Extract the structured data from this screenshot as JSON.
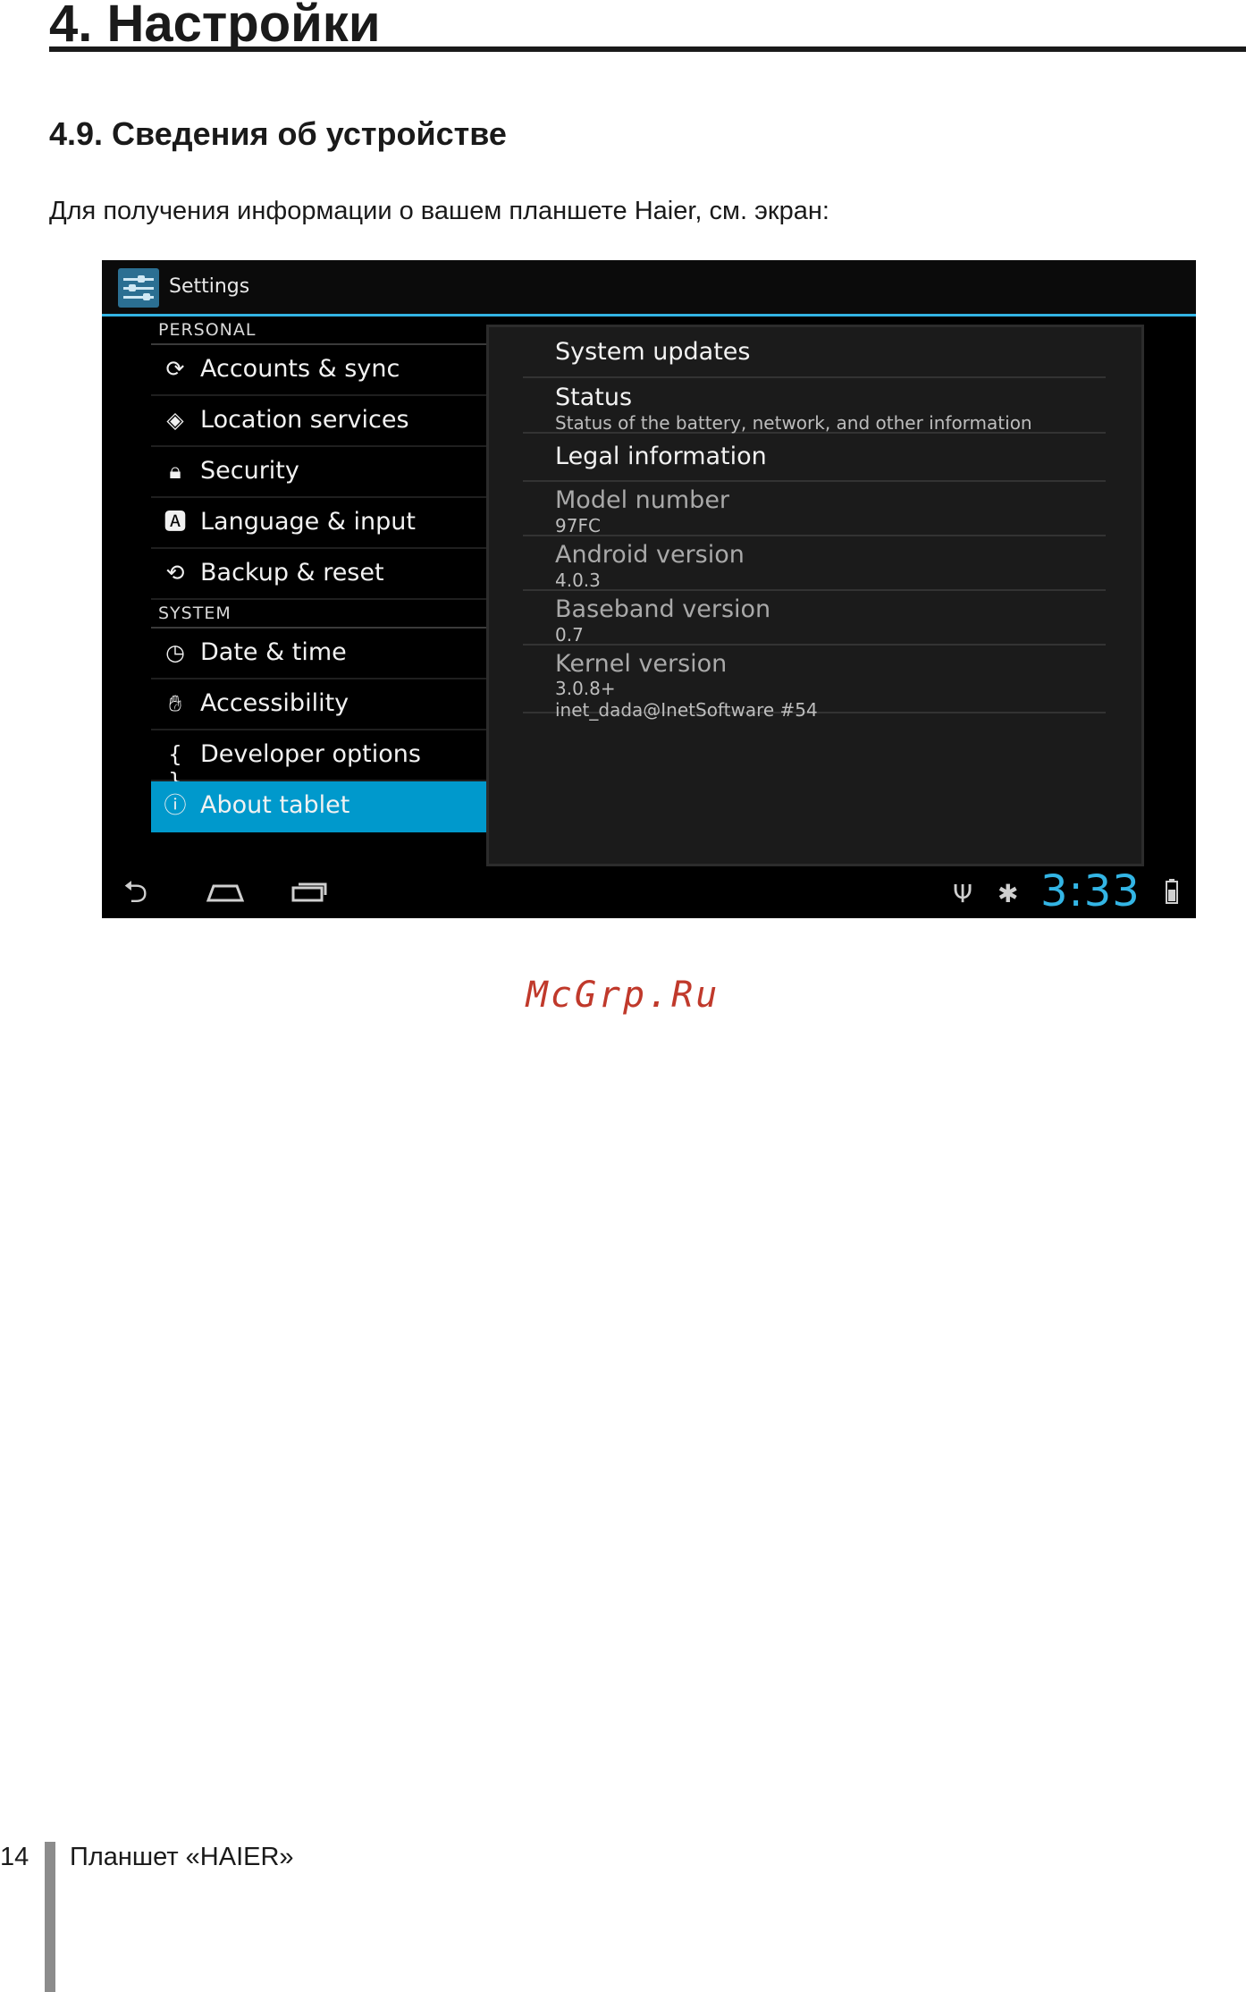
{
  "document": {
    "chapter_title": "4. Настройки",
    "section_title": "4.9. Сведения об устройстве",
    "intro_text": "Для получения информации о вашем планшете Haier, см. экран:",
    "watermark": "McGrp.Ru",
    "footer": {
      "page_number": "14",
      "text": "Планшет «HAIER»"
    }
  },
  "screenshot": {
    "action_bar": {
      "title": "Settings",
      "icon": "settings-app-icon"
    },
    "personal_header": "PERSONAL",
    "personal_items": [
      {
        "label": "Accounts & sync",
        "icon": "sync-icon",
        "glyph": "⟳"
      },
      {
        "label": "Location services",
        "icon": "location-icon",
        "glyph": "◈"
      },
      {
        "label": "Security",
        "icon": "lock-icon",
        "glyph": "🔒︎"
      },
      {
        "label": "Language & input",
        "icon": "language-icon",
        "glyph": "🅰︎"
      },
      {
        "label": "Backup & reset",
        "icon": "backup-icon",
        "glyph": "⟲"
      }
    ],
    "system_header": "SYSTEM",
    "system_items": [
      {
        "label": "Date & time",
        "icon": "clock-icon",
        "glyph": "◷"
      },
      {
        "label": "Accessibility",
        "icon": "hand-icon",
        "glyph": "✋︎"
      },
      {
        "label": "Developer options",
        "icon": "braces-icon",
        "glyph": "{ }"
      },
      {
        "label": "About tablet",
        "icon": "info-icon",
        "glyph": "ⓘ",
        "selected": true
      }
    ],
    "details": [
      {
        "title": "System updates",
        "subtitle": ""
      },
      {
        "title": "Status",
        "subtitle": "Status of the battery, network, and other information"
      },
      {
        "title": "Legal information",
        "subtitle": ""
      },
      {
        "title": "Model number",
        "subtitle": "97FC"
      },
      {
        "title": "Android version",
        "subtitle": "4.0.3"
      },
      {
        "title": "Baseband version",
        "subtitle": "0.7"
      },
      {
        "title": "Kernel version",
        "subtitle": "3.0.8+",
        "subtitle2": "inet_dada@InetSoftware #54"
      }
    ],
    "status_bar": {
      "time": "3:33"
    },
    "colors": {
      "accent": "#33b5e5",
      "selected_background": "#0099cc",
      "enabled_title": "#f2f2f2",
      "disabled_title": "#a9a9a9",
      "subtitle": "#bdbdbd"
    }
  }
}
